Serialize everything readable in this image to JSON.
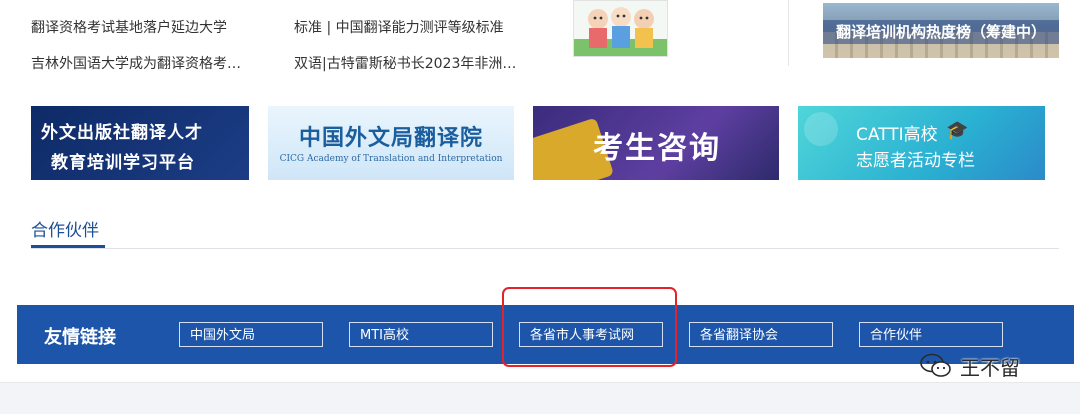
{
  "news": {
    "left": [
      "翻译资格考试基地落户延边大学",
      "吉林外国语大学成为翻译资格考…"
    ],
    "right": [
      "标准 | 中国翻译能力测评等级标准",
      "双语|古特雷斯秘书长2023年非洲…"
    ]
  },
  "ranking_banner": {
    "label": "翻译培训机构热度榜（筹建中）"
  },
  "banners": {
    "b1": {
      "line1": "外文出版社翻译人才",
      "line2": "教育培训学习平台"
    },
    "b2": {
      "title": "中国外文局翻译院",
      "subtitle": "CICG Academy of Translation and Interpretation"
    },
    "b3": {
      "title": "考生咨询"
    },
    "b4": {
      "line1": "CATTI高校",
      "line2": "志愿者活动专栏"
    }
  },
  "partners": {
    "title": "合作伙伴"
  },
  "friend_links": {
    "title": "友情链接",
    "items": [
      "中国外文局",
      "MTI高校",
      "各省市人事考试网",
      "各省翻译协会",
      "合作伙伴"
    ]
  },
  "watermark": {
    "name": "王不留"
  },
  "colors": {
    "accent": "#1d4f97",
    "bar": "#1c55a9",
    "highlight": "#e3222b"
  }
}
